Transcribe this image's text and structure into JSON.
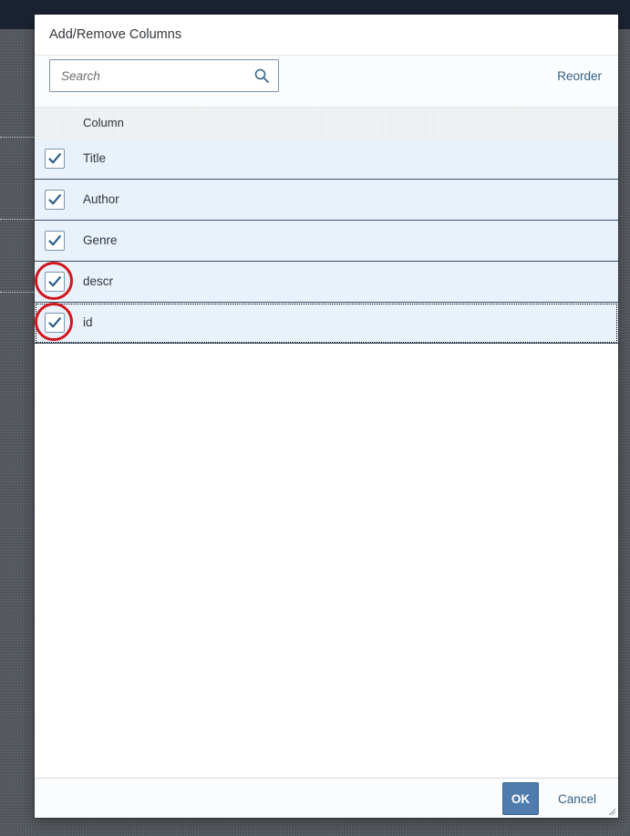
{
  "dialog": {
    "title": "Add/Remove Columns",
    "reorder_label": "Reorder",
    "search": {
      "placeholder": "Search",
      "value": ""
    },
    "column_header": "Column",
    "rows": [
      {
        "label": "Title",
        "checked": true,
        "highlighted": false
      },
      {
        "label": "Author",
        "checked": true,
        "highlighted": false
      },
      {
        "label": "Genre",
        "checked": true,
        "highlighted": false
      },
      {
        "label": "descr",
        "checked": true,
        "highlighted": true
      },
      {
        "label": "id",
        "checked": true,
        "highlighted": true,
        "focused": true
      }
    ],
    "ok_label": "OK",
    "cancel_label": "Cancel"
  },
  "colors": {
    "accent": "#346187",
    "ok_button": "#4f7cac",
    "row_selected": "#e9f2fb",
    "annotation": "#d0161e"
  },
  "icons": {
    "search": "search-icon",
    "check": "checkmark-icon",
    "resize": "resize-grip-icon"
  }
}
